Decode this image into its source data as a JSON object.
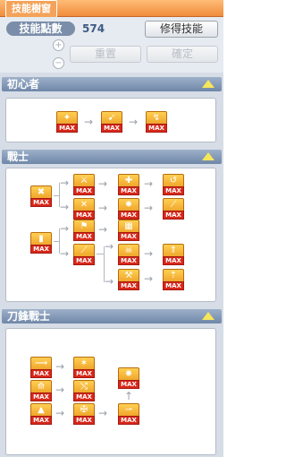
{
  "window": {
    "title": "技能樹窗"
  },
  "header": {
    "points_label": "技能點數",
    "points_value": "574",
    "relearn_label": "修得技能",
    "reset_label": "重置",
    "confirm_label": "確定",
    "plus": "+",
    "minus": "−"
  },
  "sections": [
    {
      "title": "初心者",
      "collapse_icon": "triangle-up-icon"
    },
    {
      "title": "戰士",
      "collapse_icon": "triangle-up-icon"
    },
    {
      "title": "刀鋒戰士",
      "collapse_icon": "triangle-up-icon"
    }
  ],
  "skill_badge": "MAX",
  "arrow_right": "→",
  "arrow_up": "↑",
  "colors": {
    "title_orange": "#f08c3c",
    "section_blue": "#6f87a8",
    "max_red": "#d8281b"
  }
}
